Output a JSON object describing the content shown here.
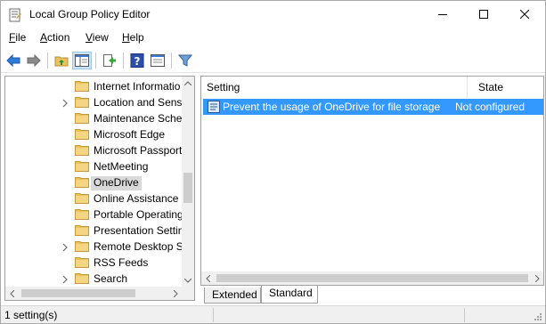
{
  "window": {
    "title": "Local Group Policy Editor"
  },
  "menu": {
    "file": "File",
    "action": "Action",
    "view": "View",
    "help": "Help"
  },
  "toolbar": {
    "icons": [
      "back-arrow-icon",
      "forward-arrow-icon",
      "up-folder-icon",
      "show-hide-tree-icon",
      "export-list-icon",
      "help-icon",
      "properties-icon",
      "filter-icon"
    ]
  },
  "tree": {
    "items": [
      {
        "label": "Internet Informatio",
        "expandable": false
      },
      {
        "label": "Location and Senso",
        "expandable": true
      },
      {
        "label": "Maintenance Schec",
        "expandable": false
      },
      {
        "label": "Microsoft Edge",
        "expandable": false
      },
      {
        "label": "Microsoft Passport",
        "expandable": false
      },
      {
        "label": "NetMeeting",
        "expandable": false
      },
      {
        "label": "OneDrive",
        "expandable": false,
        "selected": true
      },
      {
        "label": "Online Assistance",
        "expandable": false
      },
      {
        "label": "Portable Operating",
        "expandable": false
      },
      {
        "label": "Presentation Settin",
        "expandable": false
      },
      {
        "label": "Remote Desktop Se",
        "expandable": true
      },
      {
        "label": "RSS Feeds",
        "expandable": false
      },
      {
        "label": "Search",
        "expandable": true
      }
    ]
  },
  "list": {
    "columns": {
      "setting": "Setting",
      "state": "State"
    },
    "rows": [
      {
        "setting": "Prevent the usage of OneDrive for file storage",
        "state": "Not configured",
        "selected": true
      }
    ]
  },
  "tabs": {
    "extended": "Extended",
    "standard": "Standard",
    "active": "Standard"
  },
  "status": {
    "text": "1 setting(s)"
  },
  "colors": {
    "selection": "#3399ff",
    "tree_selected": "#d9d9d9",
    "folder": "#e8c25d"
  }
}
